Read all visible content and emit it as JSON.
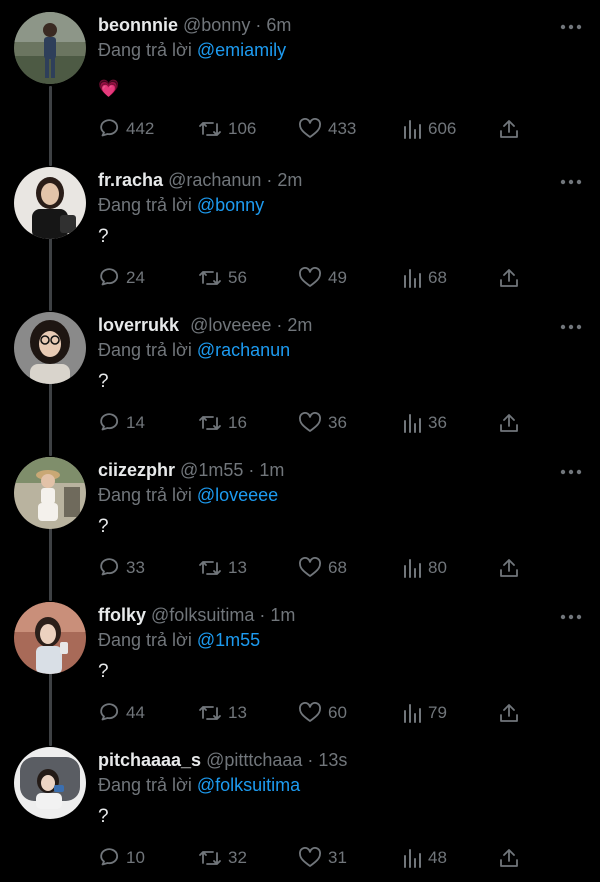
{
  "reply_prefix": "Đang trả lời",
  "colors": {
    "background": "#000000",
    "text": "#e7e9ea",
    "secondary": "#71767b",
    "mention": "#1d9bf0",
    "thread_line": "#3e4144"
  },
  "icons": {
    "reply": "speech-bubble-icon",
    "retweet": "retweet-icon",
    "like": "heart-icon",
    "views": "bar-chart-icon",
    "share": "share-upload-icon",
    "more": "more-dots-icon"
  },
  "tweets": [
    {
      "name": "beonnnie",
      "meta": "@bonny · 6m",
      "reply_to": "@emiamily",
      "text": "💗",
      "replies": "442",
      "retweets": "106",
      "likes": "433",
      "views": "606"
    },
    {
      "name": "fr.racha",
      "meta": "@rachanun · 2m",
      "reply_to": "@bonny",
      "text": "?",
      "replies": "24",
      "retweets": "56",
      "likes": "49",
      "views": "68"
    },
    {
      "name": "loverrukk",
      "meta": "@loveeee · 2m",
      "reply_to": "@rachanun",
      "text": "?",
      "replies": "14",
      "retweets": "16",
      "likes": "36",
      "views": "36"
    },
    {
      "name": "ciizezphr",
      "meta": "@1m55 · 1m",
      "reply_to": "@loveeee",
      "text": "?",
      "replies": "33",
      "retweets": "13",
      "likes": "68",
      "views": "80"
    },
    {
      "name": "ffolky",
      "meta": "@folksuitima · 1m",
      "reply_to": "@1m55",
      "text": "?",
      "replies": "44",
      "retweets": "13",
      "likes": "60",
      "views": "79"
    },
    {
      "name": "pitchaaaa_s",
      "meta": "@pitttchaaa · 13s",
      "reply_to": "@folksuitima",
      "text": "?",
      "replies": "10",
      "retweets": "32",
      "likes": "31",
      "views": "48"
    }
  ]
}
